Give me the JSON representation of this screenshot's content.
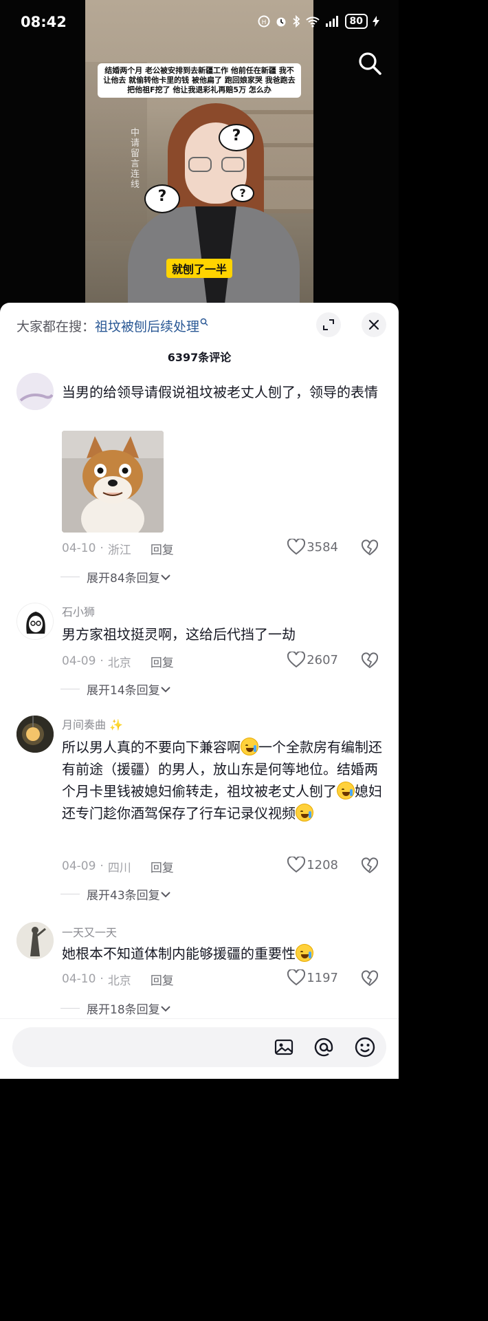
{
  "status_bar": {
    "time": "08:42",
    "battery": "80",
    "icons": [
      "hd-icon",
      "alarm-icon",
      "bluetooth-icon",
      "wifi-icon",
      "signal-icon",
      "charging-icon"
    ]
  },
  "video": {
    "caption_top": "结婚两个月 老公被安排到去新疆工作 他前任在新疆 我不让他去 就偷转他卡里的钱 被他扁了 跑回娘家哭 我爸跑去把他祖F挖了 他让我退彩礼再赔5万 怎么办",
    "caption_bottom": "就刨了一半",
    "bubble_1": "?",
    "bubble_2": "?",
    "bubble_3": "?",
    "watermark": "中请留言连线"
  },
  "sheet": {
    "hot_search_label": "大家都在搜：",
    "hot_search_term": "祖坟被刨后续处理",
    "comment_count": "6397条评论"
  },
  "comments": [
    {
      "user": "",
      "text": "当男的给领导请假说祖坟被老丈人刨了，领导的表情",
      "date": "04-10",
      "location": "浙江",
      "reply": "回复",
      "likes": "3584",
      "expand": "展开84条回复"
    },
    {
      "user": "石小狮",
      "text": "男方家祖坟挺灵啊，这给后代挡了一劫",
      "date": "04-09",
      "location": "北京",
      "reply": "回复",
      "likes": "2607",
      "expand": "展开14条回复"
    },
    {
      "user": "月间奏曲",
      "text_parts": [
        "所以男人真的不要向下兼容啊",
        "一个全款房有编制还有前途（援疆）的男人，放山东是何等地位。结婚两个月卡里钱被媳妇偷转走，祖坟被老丈人刨了",
        "媳妇还专门趁你酒驾保存了行车记录仪视频",
        ""
      ],
      "date": "04-09",
      "location": "四川",
      "reply": "回复",
      "likes": "1208",
      "expand": "展开43条回复"
    },
    {
      "user": "一天又一天",
      "text": "她根本不知道体制内能够援疆的重要性",
      "date": "04-10",
      "location": "北京",
      "reply": "回复",
      "likes": "1197",
      "expand": "展开18条回复"
    }
  ],
  "input_bar": {
    "placeholder": "",
    "icons": [
      "image-icon",
      "at-icon",
      "emoji-icon"
    ]
  }
}
